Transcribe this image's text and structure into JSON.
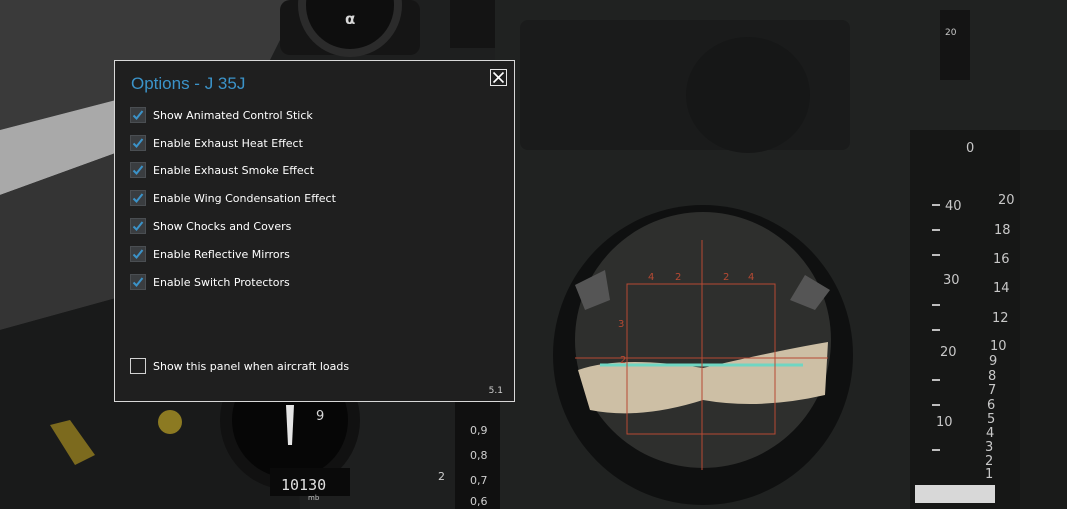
{
  "scene": {
    "altimeter_digits": "10130",
    "altimeter_unit": "mb",
    "gauge_alpha_symbol": "α",
    "airspeed_dial": "9",
    "gauge_scale_labels": [
      "0,9",
      "0,8",
      "0,7",
      "0,6"
    ],
    "gauge_scale_digit": "2",
    "sight_labels": [
      "4",
      "2",
      "2",
      "4",
      "3",
      "2"
    ],
    "tape_left_labels": [
      "40",
      "30",
      "20",
      "10"
    ],
    "tape_right_labels": [
      "20",
      "18",
      "16",
      "14",
      "12",
      "10",
      "9",
      "8",
      "7",
      "6",
      "5",
      "4",
      "3",
      "2",
      "1"
    ],
    "tape_top_label": "0",
    "corner_label": "20"
  },
  "dialog": {
    "title": "Options - J 35J",
    "close_icon": "close-icon",
    "options": [
      {
        "label": "Show Animated Control Stick",
        "checked": true
      },
      {
        "label": "Enable Exhaust Heat Effect",
        "checked": true
      },
      {
        "label": "Enable Exhaust Smoke Effect",
        "checked": true
      },
      {
        "label": "Enable Wing Condensation Effect",
        "checked": true
      },
      {
        "label": "Show Chocks and Covers",
        "checked": true
      },
      {
        "label": "Enable Reflective Mirrors",
        "checked": true
      },
      {
        "label": "Enable Switch Protectors",
        "checked": true
      }
    ],
    "startup_option": {
      "label": "Show this panel when aircraft loads",
      "checked": false
    },
    "version": "5.1",
    "colors": {
      "title": "#3b93c9",
      "check": "#3b93c9",
      "background": "#1f1f1f",
      "border": "#d8d8d8"
    }
  }
}
